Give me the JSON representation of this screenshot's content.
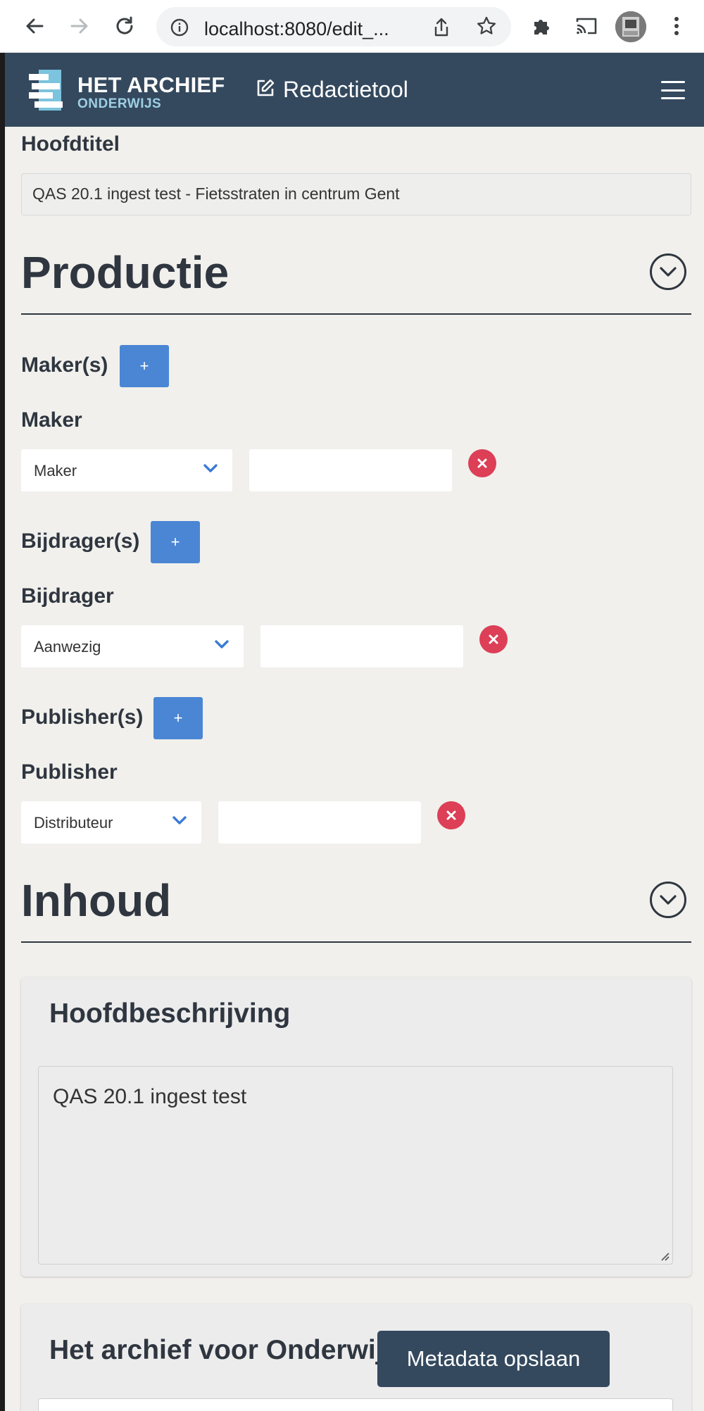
{
  "browser": {
    "url": "localhost:8080/edit_..."
  },
  "header": {
    "logo_title": "HET ARCHIEF",
    "logo_subtitle": "ONDERWIJS",
    "tool_label": "Redactietool"
  },
  "main_title": {
    "label": "Hoofdtitel",
    "value": "QAS 20.1 ingest test - Fietsstraten in centrum Gent"
  },
  "productie": {
    "title": "Productie",
    "makers": {
      "group_label": "Maker(s)",
      "add_label": "+",
      "item_label": "Maker",
      "selected": "Maker",
      "value": ""
    },
    "bijdragers": {
      "group_label": "Bijdrager(s)",
      "add_label": "+",
      "item_label": "Bijdrager",
      "selected": "Aanwezig",
      "value": ""
    },
    "publishers": {
      "group_label": "Publisher(s)",
      "add_label": "+",
      "item_label": "Publisher",
      "selected": "Distributeur",
      "value": ""
    }
  },
  "inhoud": {
    "title": "Inhoud",
    "main_description": {
      "title": "Hoofdbeschrijving",
      "value": "QAS 20.1 ingest test"
    },
    "second_card": {
      "title": "Het archief voor Onderwijs"
    }
  },
  "actions": {
    "save_label": "Metadata opslaan"
  },
  "colors": {
    "header_bg": "#34495e",
    "accent_blue": "#4a86d4",
    "danger_red": "#dc3f56",
    "page_bg": "#f1f0ec"
  }
}
